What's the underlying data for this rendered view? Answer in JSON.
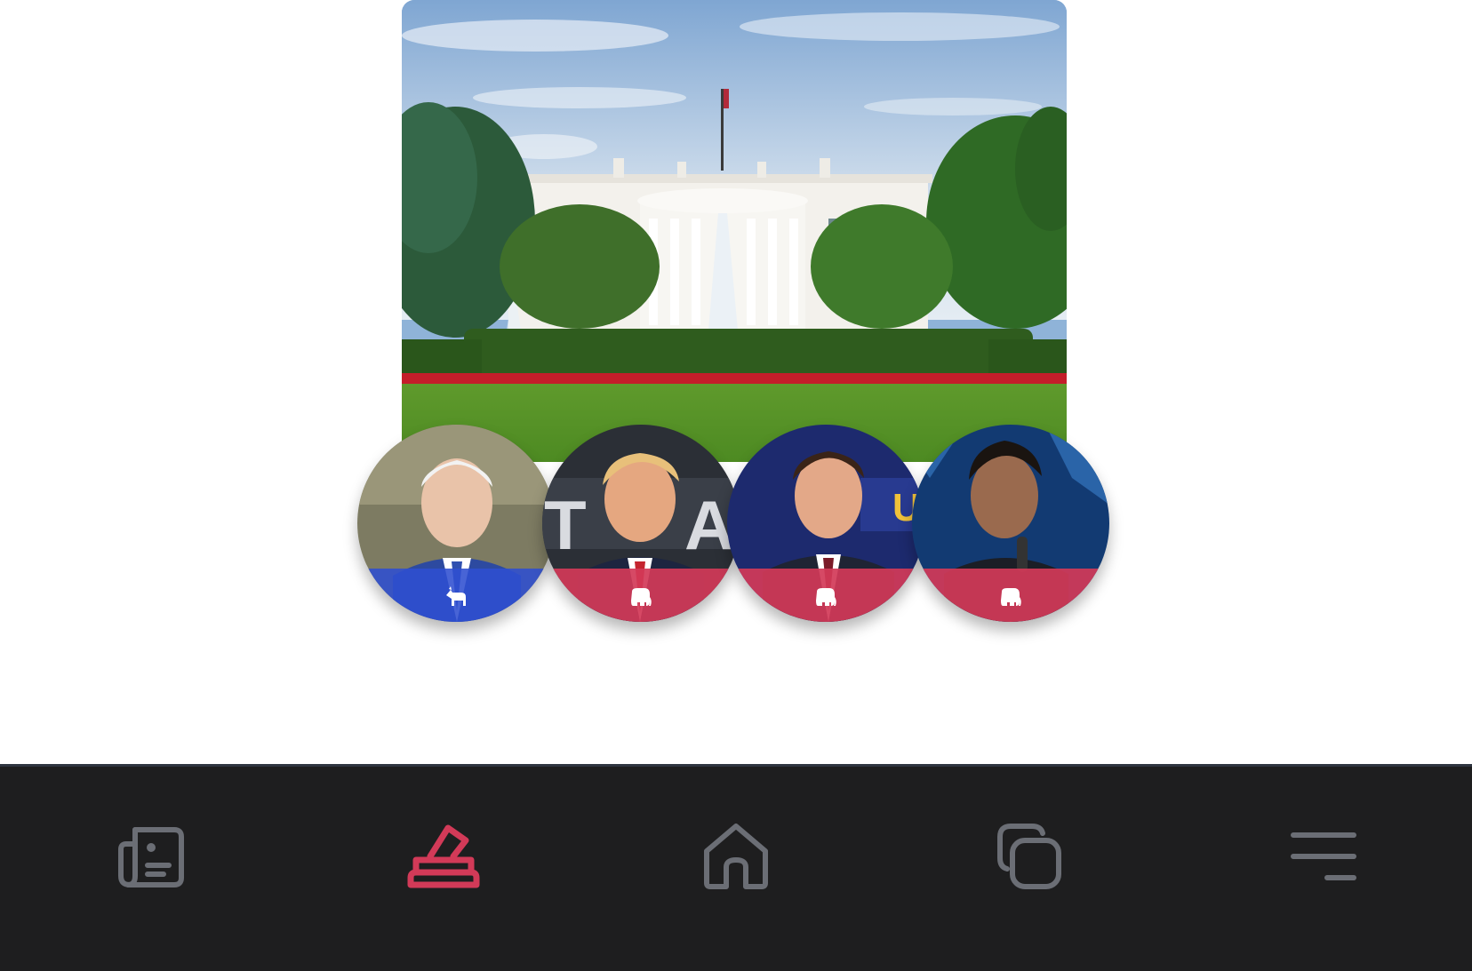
{
  "hero": {
    "image": "white-house-south-lawn-photo"
  },
  "candidates": [
    {
      "id": "candidate-1",
      "portrait": "candidate-portrait",
      "party": "democratic",
      "party_icon": "donkey-icon",
      "party_color": "#2f4fd0"
    },
    {
      "id": "candidate-2",
      "portrait": "candidate-portrait",
      "party": "republican",
      "party_icon": "elephant-icon",
      "party_color": "#d23a58"
    },
    {
      "id": "candidate-3",
      "portrait": "candidate-portrait",
      "party": "republican",
      "party_icon": "elephant-icon",
      "party_color": "#d23a58"
    },
    {
      "id": "candidate-4",
      "portrait": "candidate-portrait",
      "party": "republican",
      "party_icon": "elephant-icon",
      "party_color": "#d23a58"
    }
  ],
  "nav": {
    "items": [
      {
        "icon": "news-icon",
        "active": false
      },
      {
        "icon": "ballot-box-icon",
        "active": true
      },
      {
        "icon": "home-icon",
        "active": false
      },
      {
        "icon": "copy-icon",
        "active": false
      },
      {
        "icon": "menu-icon",
        "active": false
      }
    ],
    "active_color": "#d23a58",
    "inactive_color": "#6b6e75",
    "background": "#1e1e1f"
  }
}
